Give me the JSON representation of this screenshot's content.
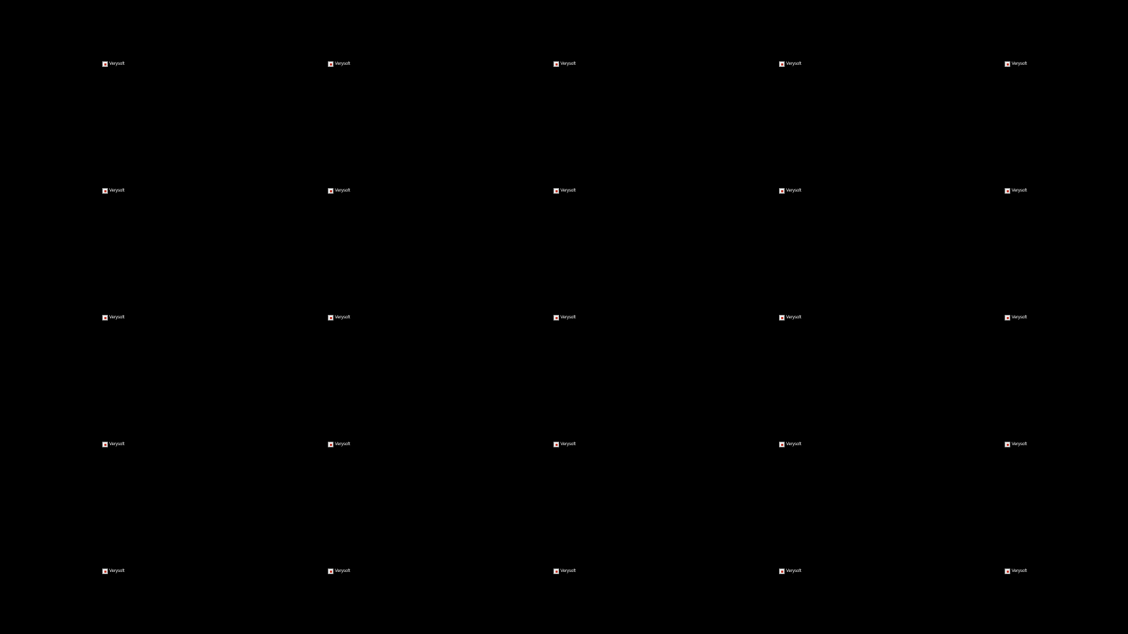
{
  "screen": {
    "background": "#000000"
  },
  "watermark": {
    "brand": "Verysoft",
    "logo_icon": "verysoft-logo-icon"
  }
}
